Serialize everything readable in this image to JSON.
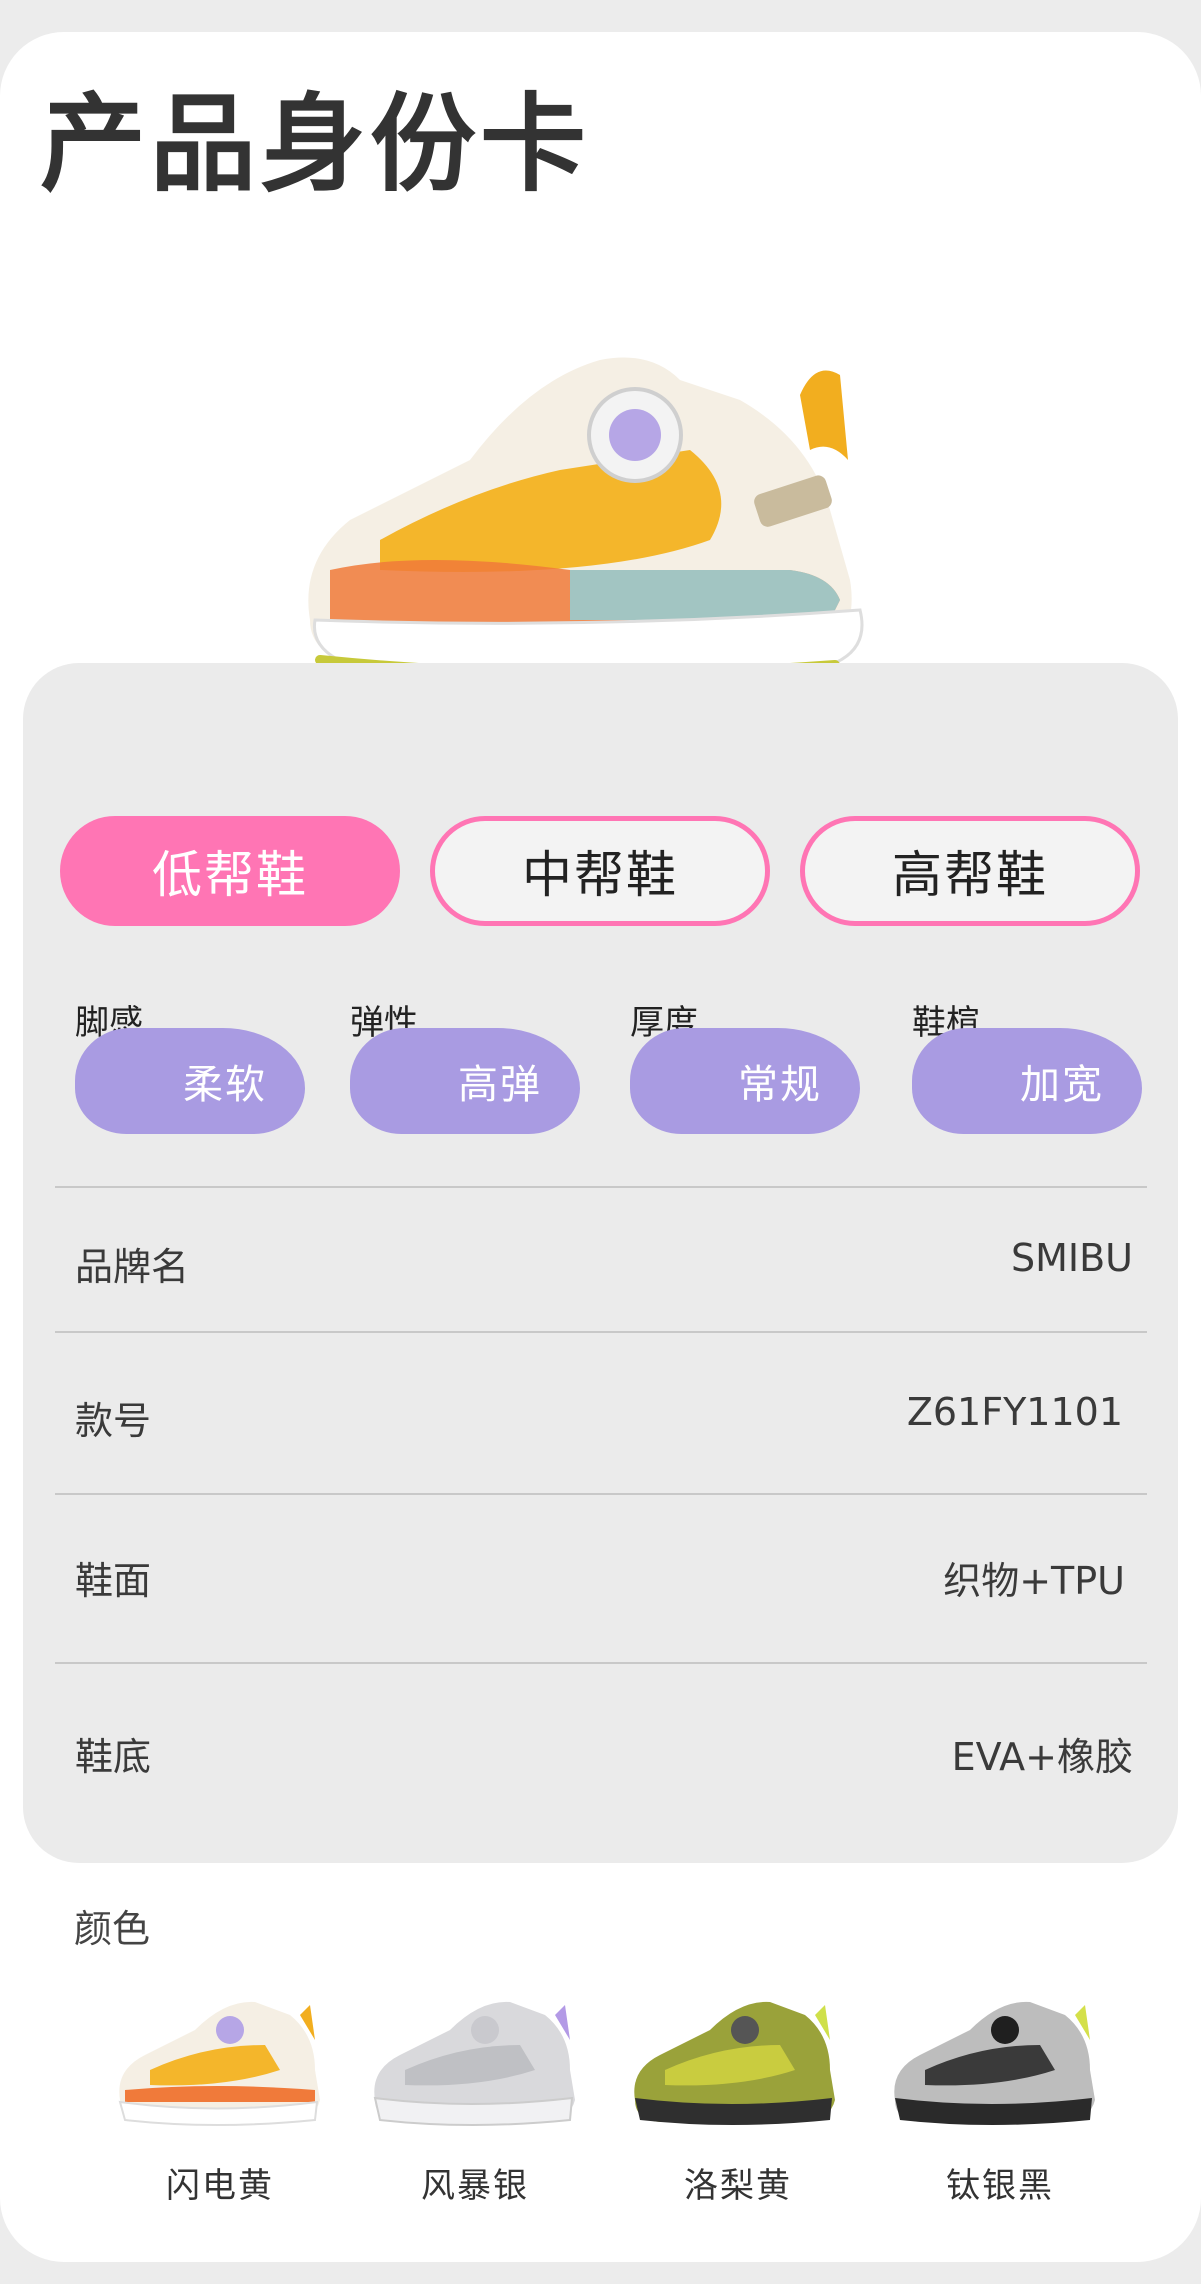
{
  "header": {
    "title": "产品身份卡"
  },
  "shoe_types": [
    {
      "label": "低帮鞋",
      "active": true
    },
    {
      "label": "中帮鞋",
      "active": false
    },
    {
      "label": "高帮鞋",
      "active": false
    }
  ],
  "features": [
    {
      "label": "脚感",
      "value": "柔软"
    },
    {
      "label": "弹性",
      "value": "高弹"
    },
    {
      "label": "厚度",
      "value": "常规"
    },
    {
      "label": "鞋楦",
      "value": "加宽"
    }
  ],
  "specs": [
    {
      "label": "品牌名",
      "value": "SMIBU"
    },
    {
      "label": "款号",
      "value": "Z61FY1101"
    },
    {
      "label": "鞋面",
      "value": "织物+TPU"
    },
    {
      "label": "鞋底",
      "value": "EVA+橡胶"
    }
  ],
  "colors": {
    "heading": "颜色",
    "items": [
      {
        "name": "闪电黄"
      },
      {
        "name": "风暴银"
      },
      {
        "name": "洛梨黄"
      },
      {
        "name": "钛银黑"
      }
    ]
  },
  "theme": {
    "accent_pink": "#ff75b4",
    "blob_purple": "#a99be2",
    "card_gray": "#ebebeb"
  }
}
